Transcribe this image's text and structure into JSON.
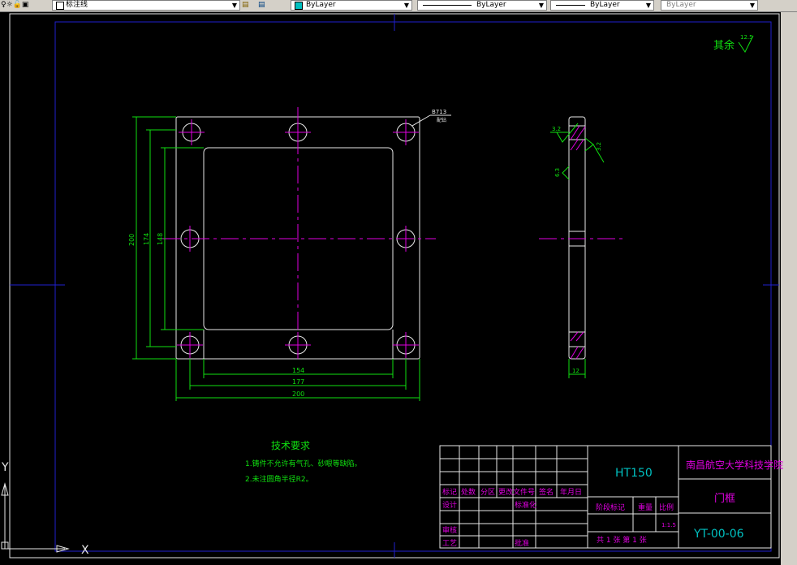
{
  "toolbar": {
    "layer_name": "标注线",
    "color_value": "ByLayer",
    "linetype_value": "ByLayer",
    "lineweight_value": "ByLayer",
    "plotstyle_value": "ByLayer"
  },
  "drawing": {
    "surface_finish_label": "其余",
    "surface_finish_value": "12.5",
    "weld_note_value": "B713",
    "weld_note_sub": "配钻",
    "dim_height_200": "200",
    "dim_height_174": "174",
    "dim_height_148": "148",
    "dim_width_154": "154",
    "dim_width_177": "177",
    "dim_width_200": "200",
    "side_roughness_1": "3.2",
    "side_roughness_2": "3.2",
    "side_roughness_3": "6.3",
    "side_thickness": "12"
  },
  "tech_requirements": {
    "title": "技术要求",
    "item1": "1.铸件不允许有气孔、砂眼等缺陷。",
    "item2": "2.未注圆角半径R2。"
  },
  "title_block": {
    "material": "HT150",
    "school": "南昌航空大学科技学院",
    "part_name": "门框",
    "drawing_no": "YT-00-06",
    "h_biaoji": "标记",
    "h_chushu": "处数",
    "h_fenqu": "分区",
    "h_gengai": "更改文件号",
    "h_qianming": "签名",
    "h_nianyueri": "年月日",
    "h_sheji": "设计",
    "h_biaozhun": "标准化",
    "h_shenhe": "审核",
    "h_gongyi": "工艺",
    "h_pizhun": "批准",
    "h_jieduan": "阶段标记",
    "h_zhongliang": "重量",
    "h_bili": "比例",
    "scale": "1:1.5",
    "sheet_info": "共 1 张 第 1 张"
  },
  "ucs": {
    "x_label": "X",
    "y_label": "Y"
  }
}
